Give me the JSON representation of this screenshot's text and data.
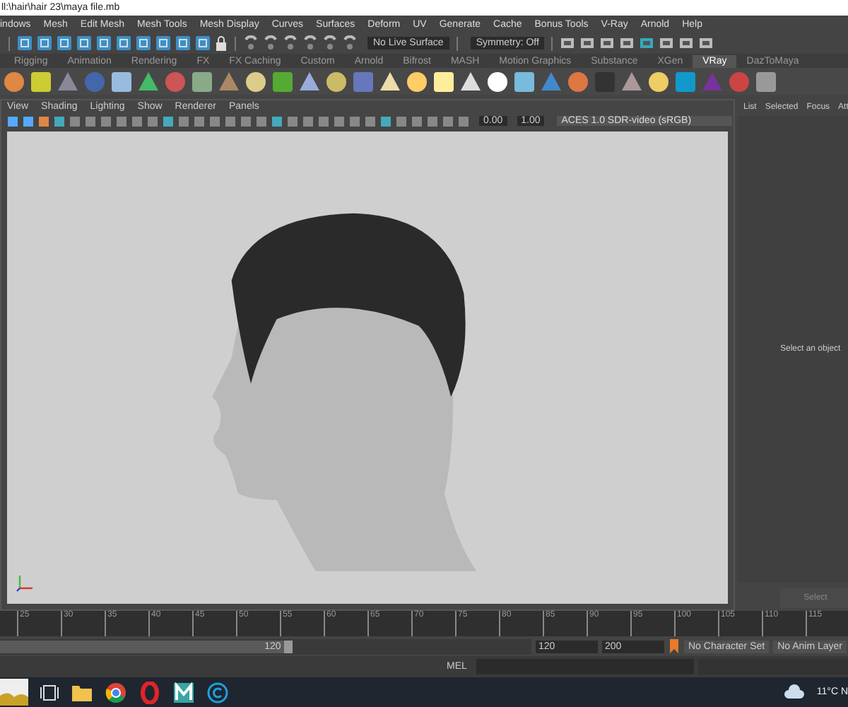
{
  "window": {
    "title": "ll:\\hair\\hair 23\\maya file.mb"
  },
  "menu_bar": [
    "indows",
    "Mesh",
    "Edit Mesh",
    "Mesh Tools",
    "Mesh Display",
    "Curves",
    "Surfaces",
    "Deform",
    "UV",
    "Generate",
    "Cache",
    "Bonus Tools",
    "V-Ray",
    "Arnold",
    "Help"
  ],
  "status_line": {
    "live_surface": "No Live Surface",
    "symmetry": "Symmetry: Off"
  },
  "shelf_tabs": [
    {
      "label": "Rigging",
      "selected": false
    },
    {
      "label": "Animation",
      "selected": false
    },
    {
      "label": "Rendering",
      "selected": false
    },
    {
      "label": "FX",
      "selected": false
    },
    {
      "label": "FX Caching",
      "selected": false
    },
    {
      "label": "Custom",
      "selected": false
    },
    {
      "label": "Arnold",
      "selected": false
    },
    {
      "label": "Bifrost",
      "selected": false
    },
    {
      "label": "MASH",
      "selected": false
    },
    {
      "label": "Motion Graphics",
      "selected": false
    },
    {
      "label": "Substance",
      "selected": false
    },
    {
      "label": "XGen",
      "selected": false
    },
    {
      "label": "VRay",
      "selected": true
    },
    {
      "label": "DazToMaya",
      "selected": false
    }
  ],
  "viewport": {
    "menu": [
      "View",
      "Shading",
      "Lighting",
      "Show",
      "Renderer",
      "Panels"
    ],
    "toolbar": {
      "exposure": "0.00",
      "gamma": "1.00",
      "color_space": "ACES 1.0 SDR-video (sRGB)"
    }
  },
  "side_panel": {
    "tabs": [
      "List",
      "Selected",
      "Focus",
      "Att"
    ],
    "message": "Select an object",
    "button": "Select"
  },
  "time_slider": {
    "ticks": [
      "25",
      "30",
      "35",
      "40",
      "45",
      "50",
      "55",
      "60",
      "65",
      "70",
      "75",
      "80",
      "85",
      "90",
      "95",
      "100",
      "105",
      "110",
      "115"
    ]
  },
  "range_slider": {
    "level": 0.55,
    "handle": "120",
    "start": "120",
    "end": "200",
    "character_set": "No Character Set",
    "anim_layer": "No Anim Layer"
  },
  "command_line": {
    "language": "MEL"
  },
  "taskbar": {
    "weather": "11°C N"
  }
}
